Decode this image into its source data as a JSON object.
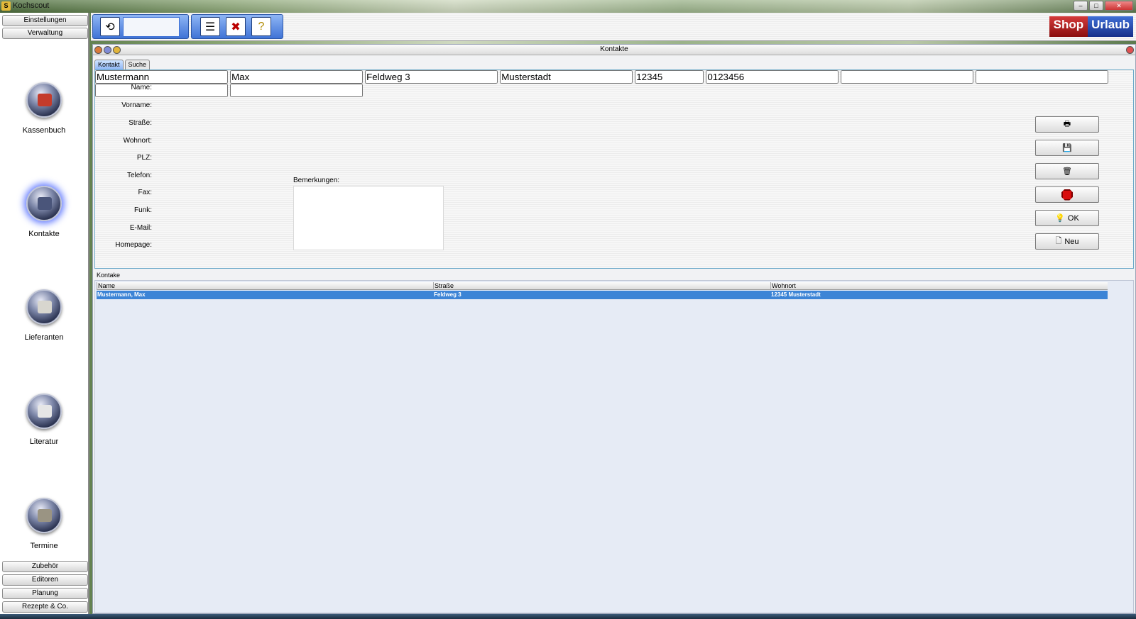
{
  "window": {
    "title": "Kochscout",
    "controls": [
      "–",
      "□",
      "✕"
    ]
  },
  "top_nav": {
    "settings": "Einstellungen",
    "admin": "Verwaltung"
  },
  "modules": [
    {
      "label": "Kassenbuch",
      "icon": "cashbook-icon",
      "active": false
    },
    {
      "label": "Kontakte",
      "icon": "contacts-icon",
      "active": true
    },
    {
      "label": "Lieferanten",
      "icon": "suppliers-icon",
      "active": false
    },
    {
      "label": "Literatur",
      "icon": "literature-icon",
      "active": false
    },
    {
      "label": "Termine",
      "icon": "appointments-icon",
      "active": false
    }
  ],
  "bottom_nav": {
    "accessories": "Zubehör",
    "editors": "Editoren",
    "planning": "Planung",
    "recipes": "Rezepte & Co."
  },
  "shop": {
    "shop": "Shop",
    "vacation": "Urlaub"
  },
  "panel": {
    "title": "Kontakte",
    "tabs": [
      "Kontakt",
      "Suche"
    ],
    "active_tab": "Kontakt"
  },
  "form": {
    "name_label": "Name:",
    "name_value": "Mustermann",
    "firstname_label": "Vorname:",
    "firstname_value": "Max",
    "street_label": "Straße:",
    "street_value": "Feldweg 3",
    "city_label": "Wohnort:",
    "city_value": "Musterstadt",
    "zip_label": "PLZ:",
    "zip_value": "12345",
    "phone_label": "Telefon:",
    "phone_value": "0123456",
    "fax_label": "Fax:",
    "fax_value": "",
    "mobile_label": "Funk:",
    "mobile_value": "",
    "email_label": "E-Mail:",
    "email_value": "",
    "homepage_label": "Homepage:",
    "homepage_value": "",
    "remarks_label": "Bemerkungen:",
    "remarks_value": ""
  },
  "actions": {
    "ok": "OK",
    "new": "Neu"
  },
  "list": {
    "group_label": "Kontake",
    "columns": [
      "Name",
      "Straße",
      "Wohnort"
    ],
    "rows": [
      {
        "name": "Mustermann, Max",
        "street": "Feldweg 3",
        "city": "12345 Musterstadt",
        "selected": true
      }
    ]
  }
}
